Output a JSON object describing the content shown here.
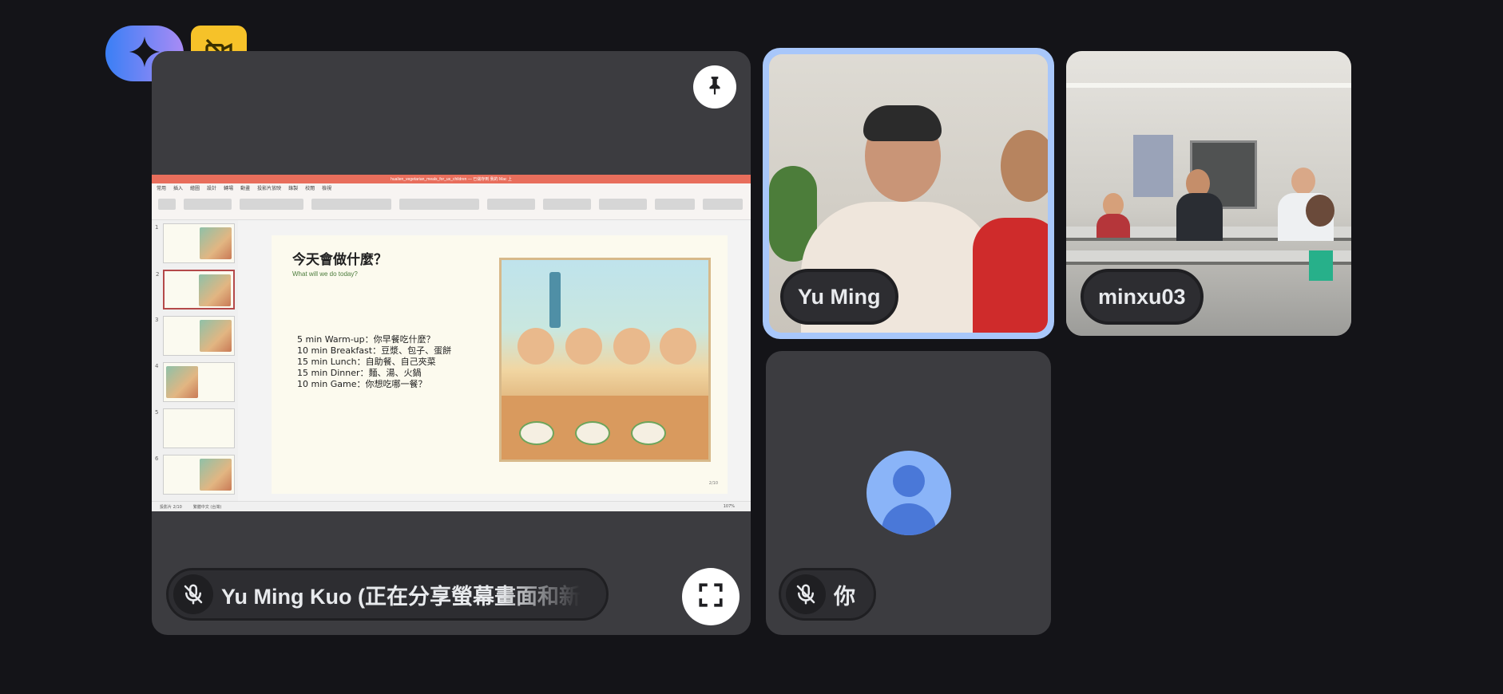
{
  "controls": {
    "gemini_icon": "sparkle-icon",
    "camera_off_icon": "video-off-icon",
    "pin_icon": "pin-icon",
    "fullscreen_icon": "fullscreen-icon"
  },
  "presentation_tile": {
    "presenter_label": "Yu Ming Kuo (正在分享螢幕畫面和新",
    "mic_muted": true
  },
  "participants": [
    {
      "name": "Yu Ming",
      "active_speaker": true
    },
    {
      "name": "minxu03",
      "active_speaker": false
    }
  ],
  "self_tile": {
    "name": "你",
    "mic_muted": true,
    "avatar_icon": "person-avatar-icon"
  },
  "shared_screen": {
    "window_title": "hualien_vegetarian_meals_for_us_children — 已儲存到 我的 Mac 上",
    "menu_tabs": [
      "常用",
      "插入",
      "繪圖",
      "設計",
      "轉場",
      "動畫",
      "投影片放映",
      "錄製",
      "校閱",
      "檢視"
    ],
    "slide_numbers": [
      "1",
      "2",
      "3",
      "4",
      "5",
      "6"
    ],
    "active_slide": 2,
    "slide": {
      "title": "今天會做什麼？",
      "subtitle": "What will we do today?",
      "agenda": [
        "5 min Warm-up：你早餐吃什麼？",
        "10 min Breakfast：豆漿、包子、蛋餅",
        "15 min Lunch：自助餐、自己夾菜",
        "15 min Dinner：麵、湯、火鍋",
        "10 min Game：你想吃哪一餐？"
      ],
      "page_label": "2/10"
    },
    "status": {
      "slide_count": "投影片 2/10",
      "language": "繁體中文 (台灣)",
      "zoom": "107%"
    }
  },
  "colors": {
    "background": "#141418",
    "tile": "#3c3c40",
    "active_border": "#a8c7fa",
    "gemini_gradient_start": "#3a7ff5",
    "gemini_gradient_end": "#a98bf5",
    "camera_off_button": "#f6c229",
    "avatar": "#8ab4f8"
  }
}
